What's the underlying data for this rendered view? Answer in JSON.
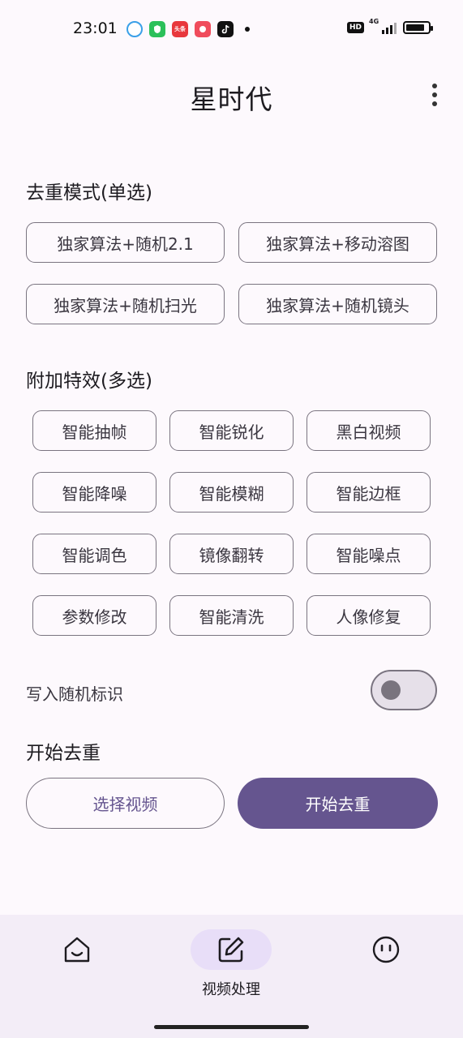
{
  "status_bar": {
    "time": "23:01",
    "notification_icons": [
      "browser-icon",
      "security-app-icon",
      "toutiao-icon",
      "video-app-icon",
      "tiktok-icon"
    ],
    "toutiao_label": "头条",
    "network": "4G",
    "hd_label": "HD"
  },
  "header": {
    "title": "星时代",
    "menu_icon": "more-vertical-icon"
  },
  "dedup_mode": {
    "title": "去重模式(单选)",
    "options": [
      "独家算法+随机2.1",
      "独家算法+移动溶图",
      "独家算法+随机扫光",
      "独家算法+随机镜头"
    ]
  },
  "effects": {
    "title": "附加特效(多选)",
    "options": [
      "智能抽帧",
      "智能锐化",
      "黑白视频",
      "智能降噪",
      "智能模糊",
      "智能边框",
      "智能调色",
      "镜像翻转",
      "智能噪点",
      "参数修改",
      "智能清洗",
      "人像修复"
    ]
  },
  "random_tag": {
    "label": "写入随机标识",
    "enabled": false
  },
  "start": {
    "title": "开始去重",
    "select_button": "选择视频",
    "start_button": "开始去重"
  },
  "bottom_nav": {
    "items": [
      {
        "icon": "home-icon",
        "label": ""
      },
      {
        "icon": "edit-icon",
        "label": "视频处理",
        "active": true
      },
      {
        "icon": "profile-icon",
        "label": ""
      }
    ]
  },
  "colors": {
    "primary": "#65558f",
    "background": "#fdf9fd",
    "nav_background": "#f3edf7",
    "nav_active": "#e8def8",
    "outline": "#7a7480"
  }
}
